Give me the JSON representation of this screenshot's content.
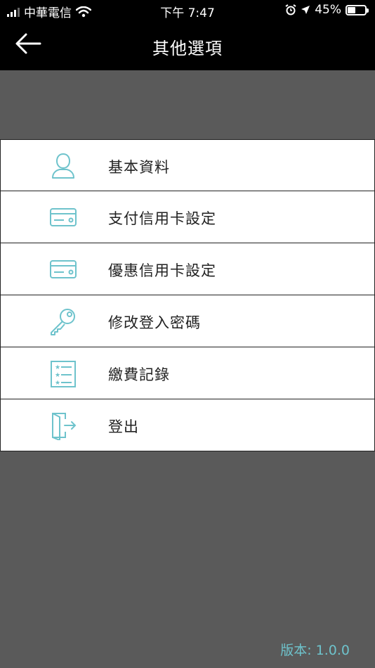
{
  "status_bar": {
    "carrier": "中華電信",
    "time": "下午 7:47",
    "battery_percent": "45%",
    "battery_level": 0.45
  },
  "nav": {
    "title": "其他選項",
    "back_icon": "arrow-left-icon"
  },
  "menu": {
    "items": [
      {
        "label": "基本資料",
        "icon": "user-icon"
      },
      {
        "label": "支付信用卡設定",
        "icon": "credit-card-icon"
      },
      {
        "label": "優惠信用卡設定",
        "icon": "credit-card-icon"
      },
      {
        "label": "修改登入密碼",
        "icon": "key-icon"
      },
      {
        "label": "繳費記錄",
        "icon": "list-icon"
      },
      {
        "label": "登出",
        "icon": "logout-icon"
      }
    ]
  },
  "version": "版本: 1.0.0",
  "colors": {
    "accent": "#6ec3cc",
    "background": "#5a5a5a",
    "nav_background": "#000000"
  }
}
